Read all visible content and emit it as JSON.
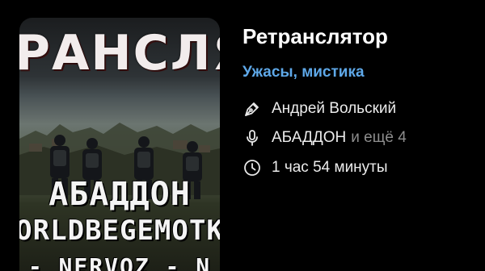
{
  "cover": {
    "title_text": "РАНСЛЯ",
    "author_line": "АБАДДОН",
    "narrator_line": "ORLDBEGEMOTK",
    "bottom_line": "- NERVOZ - N"
  },
  "book": {
    "title": "Ретранслятор",
    "genre": "Ужасы, мистика",
    "author": "Андрей Вольский",
    "reader": "АБАДДОН",
    "reader_more": "и ещё 4",
    "duration": "1 час 54 минуты"
  },
  "icons": {
    "author": "pen-icon",
    "reader": "microphone-icon",
    "duration": "clock-icon"
  },
  "colors": {
    "background": "#000000",
    "genre": "#5ea8e8",
    "secondary_text": "#8d8d8d"
  }
}
